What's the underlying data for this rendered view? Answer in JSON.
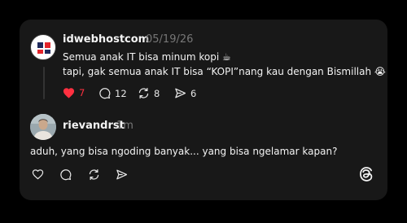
{
  "post": {
    "username": "idwebhostcom",
    "time": "05/19/26",
    "line1": "Semua anak IT bisa minum kopi ☕",
    "line2": "tapi, gak semua anak IT bisa “KOPI”nang kau dengan Bismillah 😭💍",
    "likes": "7",
    "replies": "12",
    "reposts": "8",
    "shares": "6",
    "liked": true,
    "like_color": "#ff3040"
  },
  "reply": {
    "username": "rievandrst",
    "time": "1m",
    "text": "aduh, yang bisa ngoding banyak... yang bisa ngelamar kapan?"
  },
  "colors": {
    "background": "#000000",
    "card": "#181818",
    "text": "#f3f3f3",
    "muted": "#777777"
  }
}
